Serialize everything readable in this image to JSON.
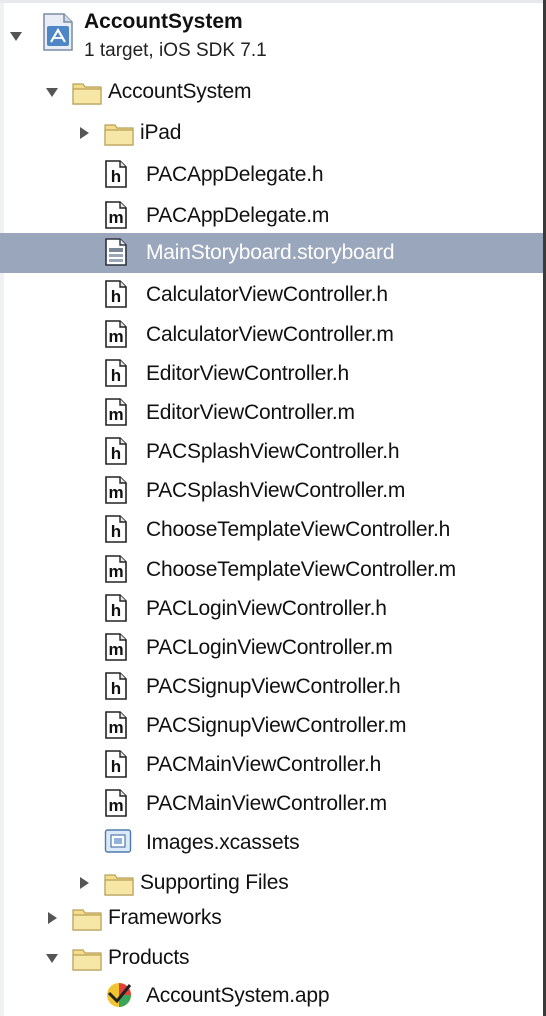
{
  "project": {
    "name": "AccountSystem",
    "subtitle": "1 target, iOS SDK 7.1"
  },
  "items": [
    {
      "label": "AccountSystem",
      "kind": "folder",
      "expanded": true
    },
    {
      "label": "iPad",
      "kind": "folder",
      "expanded": false
    },
    {
      "label": "PACAppDelegate.h",
      "kind": "h"
    },
    {
      "label": "PACAppDelegate.m",
      "kind": "m"
    },
    {
      "label": "MainStoryboard.storyboard",
      "kind": "storyboard",
      "selected": true
    },
    {
      "label": "CalculatorViewController.h",
      "kind": "h"
    },
    {
      "label": "CalculatorViewController.m",
      "kind": "m"
    },
    {
      "label": "EditorViewController.h",
      "kind": "h"
    },
    {
      "label": "EditorViewController.m",
      "kind": "m"
    },
    {
      "label": "PACSplashViewController.h",
      "kind": "h"
    },
    {
      "label": "PACSplashViewController.m",
      "kind": "m"
    },
    {
      "label": "ChooseTemplateViewController.h",
      "kind": "h"
    },
    {
      "label": "ChooseTemplateViewController.m",
      "kind": "m"
    },
    {
      "label": "PACLoginViewController.h",
      "kind": "h"
    },
    {
      "label": "PACLoginViewController.m",
      "kind": "m"
    },
    {
      "label": "PACSignupViewController.h",
      "kind": "h"
    },
    {
      "label": "PACSignupViewController.m",
      "kind": "m"
    },
    {
      "label": "PACMainViewController.h",
      "kind": "h"
    },
    {
      "label": "PACMainViewController.m",
      "kind": "m"
    },
    {
      "label": "Images.xcassets",
      "kind": "assets"
    },
    {
      "label": "Supporting Files",
      "kind": "folder",
      "expanded": false
    },
    {
      "label": "Frameworks",
      "kind": "folder",
      "expanded": false
    },
    {
      "label": "Products",
      "kind": "folder",
      "expanded": true
    },
    {
      "label": "AccountSystem.app",
      "kind": "app"
    }
  ],
  "colors": {
    "selection": "#9aa6bb",
    "folder": "#f3dc8a",
    "text": "#111111"
  }
}
